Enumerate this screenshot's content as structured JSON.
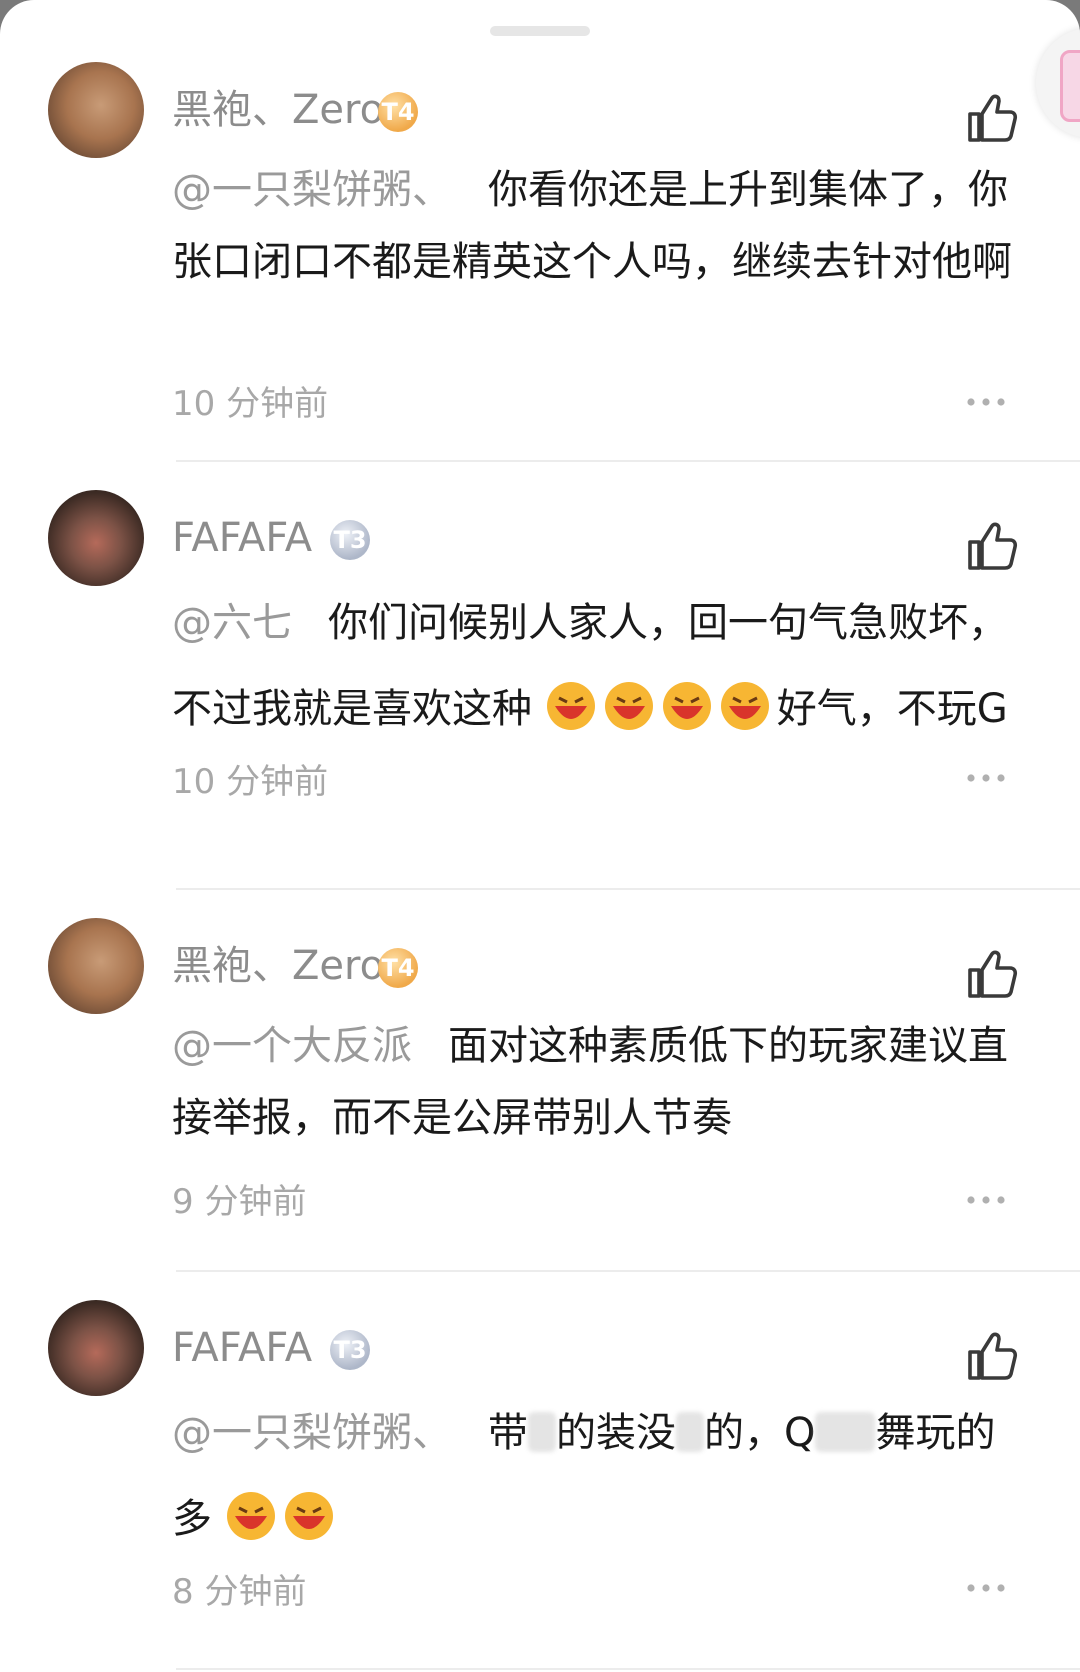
{
  "comments": [
    {
      "author": "黑袍、Zero",
      "level": "T4",
      "mention": "@一只梨饼粥、",
      "body": "你看你还是上升到集体了，你张口闭口不都是精英这个人吗，继续去针对他啊",
      "time": "10 分钟前",
      "avatar_icon": "poodle-avatar"
    },
    {
      "author": "FAFAFA",
      "level": "T3",
      "mention": "@六七",
      "body_before": "你们问候别人家人，回一句气急败坏，不过我就是喜欢这种",
      "emoji_count": 4,
      "body_after": "好气，不玩G",
      "time": "10 分钟前",
      "avatar_icon": "game-room-avatar"
    },
    {
      "author": "黑袍、Zero",
      "level": "T4",
      "mention": "@一个大反派",
      "body": "面对这种素质低下的玩家建议直接举报，而不是公屏带别人节奏",
      "time": "9 分钟前",
      "avatar_icon": "poodle-avatar"
    },
    {
      "author": "FAFAFA",
      "level": "T3",
      "mention": "@一只梨饼粥、",
      "body_p1": "带",
      "body_p2": "的装没",
      "body_p3": "的，Q",
      "body_p4": "舞玩的多",
      "emoji_count": 2,
      "time": "8 分钟前",
      "avatar_icon": "game-room-avatar"
    }
  ],
  "icons": {
    "like": "thumbs-up-icon",
    "more": "more-dots-icon",
    "emoji": "grinning-face-emoji"
  },
  "colors": {
    "author": "#8c8c8c",
    "mention": "#9a9a9a",
    "body": "#1a1a1a",
    "time": "#a8a8a8"
  }
}
